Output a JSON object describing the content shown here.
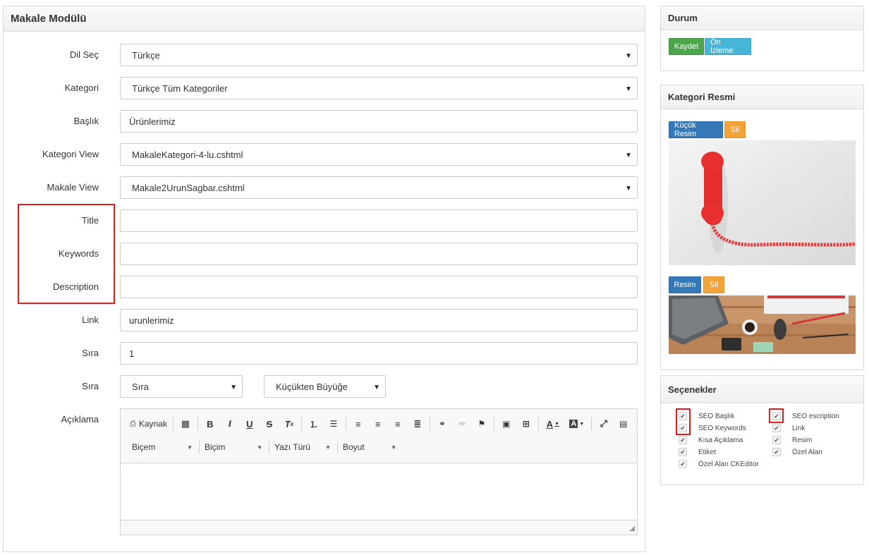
{
  "main": {
    "title": "Makale Modülü",
    "fields": {
      "dil_label": "Dil Seç",
      "dil_value": "Türkçe",
      "kategori_label": "Kategori",
      "kategori_value": "Türkçe Tüm Kategoriler",
      "baslik_label": "Başlık",
      "baslik_value": "Ürünlerimiz",
      "kategori_view_label": "Kategori View",
      "kategori_view_value": "MakaleKategori-4-lu.cshtml",
      "makale_view_label": "Makale View",
      "makale_view_value": "Makale2UrunSagbar.cshtml",
      "title_label": "Title",
      "title_value": "",
      "keywords_label": "Keywords",
      "keywords_value": "",
      "description_label": "Description",
      "description_value": "",
      "link_label": "Link",
      "link_value": "urunlerimiz",
      "sira_label": "Sıra",
      "sira_value": "1",
      "sira2_label": "Sıra",
      "sira2_value": "Sıra",
      "order_value": "Küçükten Büyüğe",
      "aciklama_label": "Açıklama"
    },
    "editor": {
      "source_label": "Kaynak",
      "combos": [
        "Biçem",
        "Biçim",
        "Yazı Türü",
        "Boyut"
      ]
    }
  },
  "durum": {
    "title": "Durum",
    "save_label": "Kaydet",
    "preview_label": "Ön İzleme"
  },
  "kategori_resmi": {
    "title": "Kategori Resmi",
    "small_image_label": "Küçük Resim",
    "delete_label": "Sil",
    "image_label": "Resim",
    "delete2_label": "Sil"
  },
  "secenekler": {
    "title": "Seçenekler",
    "left": [
      "SEO Başlık",
      "SEO Keywords",
      "Kısa Açıklama",
      "Etiket",
      "Özel Alan CKEditor"
    ],
    "right": [
      "SEO escription",
      "Link",
      "Resim",
      "Özel Alan"
    ]
  },
  "colors": {
    "highlight": "#e31b1b",
    "save": "#4ca64c",
    "preview": "#45b6d8",
    "primary": "#3478b8",
    "danger": "#f2a43a"
  }
}
